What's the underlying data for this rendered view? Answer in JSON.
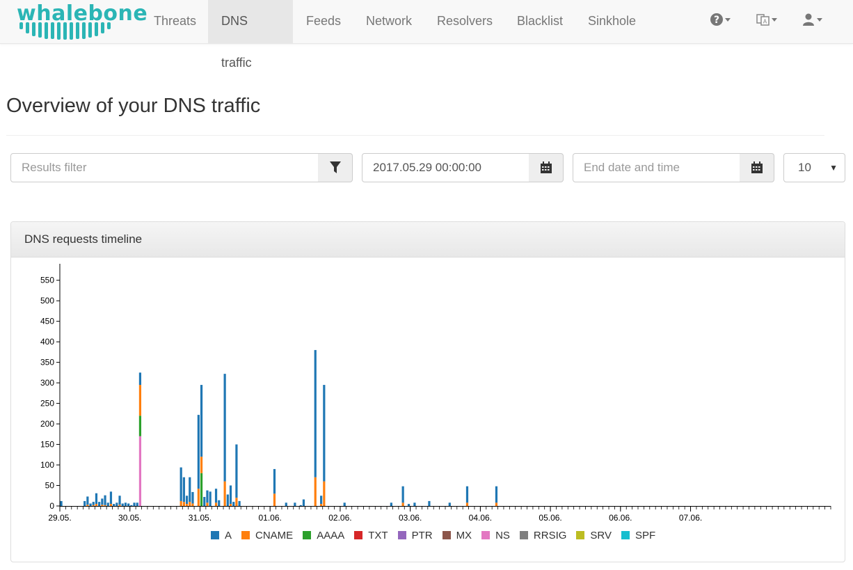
{
  "brand": {
    "name": "whalebone"
  },
  "nav": {
    "items": [
      {
        "label": "Threats"
      },
      {
        "label": "DNS traffic"
      },
      {
        "label": "Feeds"
      },
      {
        "label": "Network"
      },
      {
        "label": "Resolvers"
      },
      {
        "label": "Blacklist"
      },
      {
        "label": "Sinkhole"
      }
    ],
    "active": "DNS traffic",
    "icons": [
      "help-icon",
      "language-icon",
      "user-icon"
    ]
  },
  "page": {
    "title": "Overview of your DNS traffic"
  },
  "filters": {
    "results_placeholder": "Results filter",
    "start_value": "2017.05.29 00:00:00",
    "end_placeholder": "End date and time",
    "page_size": "10"
  },
  "panel": {
    "title": "DNS requests timeline"
  },
  "colors": {
    "A": "#1f77b4",
    "CNAME": "#ff7f0e",
    "AAAA": "#2ca02c",
    "TXT": "#d62728",
    "PTR": "#9467bd",
    "MX": "#8c564b",
    "NS": "#e377c2",
    "RRSIG": "#7f7f7f",
    "SRV": "#bcbd22",
    "SPF": "#17becf"
  },
  "chart_data": {
    "type": "bar",
    "stacked": true,
    "x_start": "2017-05-29T00:00",
    "x_step_hours": 1,
    "xticks": [
      "29.05.",
      "30.05.",
      "31.05.",
      "01.06.",
      "02.06.",
      "03.06.",
      "04.06.",
      "05.06.",
      "06.06.",
      "07.06."
    ],
    "yticks": [
      0,
      50,
      100,
      150,
      200,
      250,
      300,
      350,
      400,
      450,
      500,
      550
    ],
    "ylim": [
      0,
      580
    ],
    "grid": false,
    "legend_position": "bottom",
    "series": [
      {
        "name": "A",
        "values": [
          12,
          0,
          0,
          0,
          0,
          0,
          0,
          0,
          12,
          20,
          6,
          8,
          26,
          10,
          15,
          24,
          8,
          30,
          5,
          8,
          22,
          6,
          8,
          6,
          2,
          8,
          8,
          30,
          0,
          0,
          0,
          0,
          0,
          0,
          0,
          0,
          0,
          0,
          0,
          0,
          0,
          82,
          60,
          20,
          60,
          28,
          0,
          180,
          175,
          22,
          30,
          35,
          0,
          34,
          14,
          0,
          262,
          28,
          45,
          10,
          130,
          12,
          0,
          0,
          0,
          0,
          0,
          0,
          0,
          0,
          0,
          0,
          0,
          60,
          0,
          0,
          0,
          8,
          0,
          0,
          8,
          0,
          2,
          16,
          0,
          0,
          0,
          310,
          0,
          20,
          235,
          0,
          0,
          0,
          0,
          0,
          0,
          8,
          0,
          0,
          0,
          0,
          0,
          0,
          0,
          0,
          0,
          0,
          0,
          0,
          0,
          0,
          0,
          8,
          0,
          0,
          0,
          40,
          0,
          5,
          0,
          8,
          0,
          0,
          0,
          0,
          12,
          0,
          0,
          0,
          0,
          0,
          0,
          8,
          0,
          0,
          0,
          0,
          0,
          40,
          0,
          0,
          0,
          0,
          0,
          0,
          0,
          0,
          0,
          40,
          0,
          0,
          0,
          0,
          0,
          0,
          0,
          0,
          0,
          0,
          0,
          0,
          0,
          0,
          0,
          0,
          0,
          0,
          0,
          0,
          0,
          0,
          0,
          0,
          0,
          0,
          0,
          0,
          0,
          0,
          0,
          0,
          0,
          0,
          0,
          0,
          0,
          0,
          0,
          0,
          0,
          0,
          0,
          0,
          0,
          0,
          0,
          0,
          0,
          0,
          0,
          0,
          0,
          0,
          0,
          0,
          0,
          0,
          0,
          0,
          0,
          0,
          0,
          0,
          0,
          0,
          0,
          0,
          0,
          0,
          0,
          0,
          0,
          0,
          0,
          0,
          0,
          0,
          0,
          0,
          0,
          0,
          0,
          0,
          0,
          0,
          0,
          0,
          0,
          0,
          0,
          0,
          0,
          0,
          0,
          0,
          0,
          0,
          0,
          0,
          0,
          0,
          0,
          0,
          0,
          0,
          0,
          0,
          0,
          0,
          0,
          0,
          0,
          0,
          0,
          0,
          0,
          0,
          0,
          0,
          0,
          0,
          0,
          0,
          0,
          0,
          0,
          0,
          0,
          0,
          0,
          0,
          0,
          0,
          0,
          0,
          0,
          0,
          0,
          0,
          0,
          0,
          0,
          0,
          0,
          0,
          0
        ]
      },
      {
        "name": "CNAME",
        "values": [
          0,
          0,
          0,
          0,
          0,
          0,
          0,
          0,
          0,
          3,
          0,
          2,
          5,
          0,
          3,
          2,
          0,
          5,
          0,
          0,
          3,
          0,
          0,
          0,
          0,
          0,
          0,
          75,
          0,
          0,
          0,
          0,
          0,
          0,
          0,
          0,
          0,
          0,
          0,
          0,
          0,
          12,
          10,
          5,
          10,
          6,
          0,
          42,
          40,
          0,
          8,
          0,
          0,
          8,
          0,
          0,
          60,
          0,
          5,
          0,
          20,
          0,
          0,
          0,
          0,
          0,
          0,
          0,
          0,
          0,
          0,
          0,
          0,
          30,
          0,
          0,
          0,
          0,
          0,
          0,
          0,
          0,
          0,
          0,
          0,
          0,
          0,
          70,
          0,
          5,
          60,
          0,
          0,
          0,
          0,
          0,
          0,
          0,
          0,
          0,
          0,
          0,
          0,
          0,
          0,
          0,
          0,
          0,
          0,
          0,
          0,
          0,
          0,
          0,
          0,
          0,
          0,
          8,
          0,
          0,
          0,
          0,
          0,
          0,
          0,
          0,
          0,
          0,
          0,
          0,
          0,
          0,
          0,
          0,
          0,
          0,
          0,
          0,
          0,
          8,
          0,
          0,
          0,
          0,
          0,
          0,
          0,
          0,
          0,
          8,
          0,
          0,
          0,
          0,
          0,
          0,
          0,
          0,
          0,
          0,
          0,
          0,
          0,
          0,
          0,
          0,
          0,
          0,
          0,
          0,
          0,
          0,
          0,
          0,
          0,
          0,
          0,
          0,
          0,
          0,
          0,
          0,
          0,
          0,
          0,
          0,
          0,
          0,
          0,
          0,
          0,
          0,
          0,
          0,
          0,
          0,
          0,
          0,
          0,
          0,
          0,
          0,
          0,
          0,
          0,
          0,
          0,
          0,
          0,
          0,
          0,
          0,
          0,
          0,
          0,
          0,
          0,
          0,
          0,
          0,
          0,
          0,
          0,
          0,
          0,
          0,
          0,
          0,
          0,
          0,
          0,
          0,
          0,
          0,
          0,
          0,
          0,
          0,
          0,
          0,
          0,
          0,
          0,
          0,
          0,
          0,
          0,
          0,
          0,
          0,
          0,
          0,
          0,
          0,
          0,
          0,
          0,
          0,
          0,
          0,
          0,
          0,
          0,
          0,
          0,
          0,
          0,
          0,
          0,
          0,
          0,
          0,
          0,
          0,
          0,
          0,
          0,
          0,
          0,
          0,
          0,
          0,
          0,
          0,
          0,
          0,
          0,
          0,
          0,
          0,
          0
        ]
      },
      {
        "name": "AAAA",
        "values": [
          0,
          0,
          0,
          0,
          0,
          0,
          0,
          0,
          0,
          0,
          0,
          0,
          0,
          0,
          0,
          0,
          0,
          0,
          0,
          0,
          0,
          0,
          0,
          0,
          0,
          0,
          0,
          50,
          0,
          0,
          0,
          0,
          0,
          0,
          0,
          0,
          0,
          0,
          0,
          0,
          0,
          0,
          0,
          0,
          0,
          0,
          0,
          0,
          80,
          0,
          0,
          0,
          0,
          0,
          0,
          0,
          0,
          0,
          0,
          0,
          0,
          0,
          0,
          0,
          0,
          0,
          0,
          0,
          0,
          0,
          0,
          0,
          0,
          0,
          0,
          0,
          0,
          0,
          0,
          0,
          0,
          0,
          0,
          0,
          0,
          0,
          0,
          0,
          0,
          0,
          0,
          0,
          0,
          0,
          0,
          0,
          0,
          0,
          0,
          0,
          0,
          0,
          0,
          0,
          0,
          0,
          0,
          0,
          0,
          0,
          0,
          0,
          0,
          0,
          0,
          0,
          0,
          0,
          0,
          0,
          0,
          0,
          0,
          0,
          0,
          0,
          0,
          0,
          0,
          0,
          0,
          0,
          0,
          0,
          0,
          0,
          0,
          0,
          0,
          0,
          0,
          0,
          0,
          0,
          0,
          0,
          0,
          0,
          0,
          0,
          0,
          0,
          0,
          0,
          0,
          0,
          0,
          0,
          0,
          0,
          0,
          0,
          0,
          0,
          0,
          0,
          0,
          0,
          0,
          0,
          0,
          0,
          0,
          0,
          0,
          0,
          0,
          0,
          0,
          0,
          0,
          0,
          0,
          0,
          0,
          0,
          0,
          0,
          0,
          0,
          0,
          0,
          0,
          0,
          0,
          0,
          0,
          0,
          0,
          0,
          0,
          0,
          0,
          0,
          0,
          0,
          0,
          0,
          0,
          0,
          0,
          0,
          0,
          0,
          0,
          0,
          0,
          0,
          0,
          0,
          0,
          0,
          0,
          0,
          0,
          0,
          0,
          0,
          0,
          0,
          0,
          0,
          0,
          0,
          0,
          0,
          0,
          0,
          0,
          0,
          0,
          0,
          0,
          0,
          0,
          0,
          0,
          0,
          0,
          0,
          0,
          0,
          0,
          0,
          0,
          0,
          0,
          0,
          0,
          0,
          0,
          0,
          0,
          0,
          0,
          0,
          0,
          0,
          0,
          0,
          0,
          0,
          0,
          0,
          0,
          0,
          0,
          0,
          0,
          0,
          0,
          0,
          0,
          0,
          0,
          0
        ]
      },
      {
        "name": "NS",
        "values": [
          0,
          0,
          0,
          0,
          0,
          0,
          0,
          0,
          0,
          0,
          0,
          0,
          0,
          0,
          0,
          0,
          0,
          0,
          0,
          0,
          0,
          0,
          0,
          0,
          0,
          0,
          0,
          170,
          0,
          0,
          0,
          0,
          0,
          0,
          0,
          0,
          0,
          0,
          0,
          0,
          0,
          0,
          0,
          0,
          0,
          0,
          0,
          0,
          0,
          0,
          0,
          0,
          0,
          0,
          0,
          0,
          0,
          0,
          0,
          0,
          0,
          0,
          0,
          0,
          0,
          0,
          0,
          0,
          0,
          0,
          0,
          0,
          0,
          0,
          0,
          0,
          0,
          0,
          0,
          0,
          0,
          0,
          0,
          0,
          0,
          0,
          0,
          0,
          0,
          0,
          0,
          0,
          0,
          0,
          0,
          0,
          0,
          0,
          0,
          0,
          0,
          0,
          0,
          0,
          0,
          0,
          0,
          0,
          0,
          0,
          0,
          0,
          0,
          0,
          0,
          0,
          0,
          0,
          0,
          0,
          0,
          0,
          0,
          0,
          0,
          0,
          0,
          0,
          0,
          0,
          0,
          0,
          0,
          0,
          0,
          0,
          0,
          0,
          0,
          0,
          0,
          0,
          0,
          0,
          0,
          0,
          0,
          0,
          0,
          0,
          0,
          0,
          0,
          0,
          0,
          0,
          0,
          0,
          0,
          0,
          0,
          0,
          0,
          0,
          0,
          0,
          0,
          0,
          0,
          0,
          0,
          0,
          0,
          0,
          0,
          0,
          0,
          0,
          0,
          0,
          0,
          0,
          0,
          0,
          0,
          0,
          0,
          0,
          0,
          0,
          0,
          0,
          0,
          0,
          0,
          0,
          0,
          0,
          0,
          0,
          0,
          0,
          0,
          0,
          0,
          0,
          0,
          0,
          0,
          0,
          0,
          0,
          0,
          0,
          0,
          0,
          0,
          0,
          0,
          0,
          0,
          0,
          0,
          0,
          0,
          0,
          0,
          0,
          0,
          0,
          0,
          0,
          0,
          0,
          0,
          0,
          0,
          0,
          0,
          0,
          0,
          0,
          0,
          0,
          0,
          0,
          0,
          0,
          0,
          0,
          0,
          0,
          0,
          0,
          0,
          0,
          0,
          0,
          0,
          0,
          0,
          0,
          0,
          0,
          0,
          0,
          0,
          0,
          0,
          0,
          0,
          0,
          0,
          0,
          0,
          0,
          0,
          0,
          0,
          0,
          0,
          0,
          0,
          0,
          0,
          0,
          0
        ]
      }
    ],
    "legend": [
      "A",
      "CNAME",
      "AAAA",
      "TXT",
      "PTR",
      "MX",
      "NS",
      "RRSIG",
      "SRV",
      "SPF"
    ]
  }
}
